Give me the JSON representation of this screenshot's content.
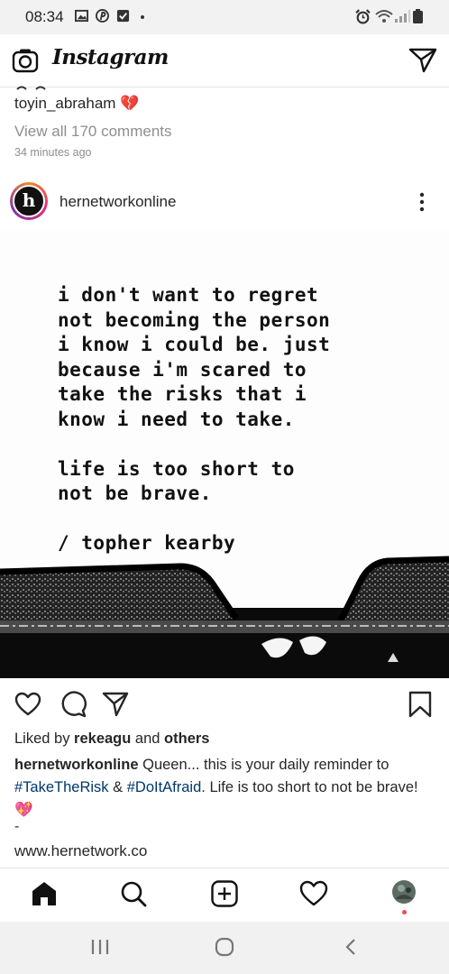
{
  "status_bar": {
    "time": "08:34"
  },
  "header": {
    "app_title": "Instagram"
  },
  "previous_post": {
    "username": "toyin_abraham",
    "username_emoji": "💔",
    "view_comments": "View all 170 comments",
    "time_ago": "34 minutes ago"
  },
  "post": {
    "avatar_letter": "h",
    "username": "hernetworkonline",
    "image_text": "i don't want to regret\nnot becoming the person\ni know i could be. just\nbecause i'm scared to\ntake the risks that i\nknow i need to take.\n\nlife is too short to\nnot be brave.\n\n/ topher kearby",
    "likes_prefix": "Liked by ",
    "likes_user": "rekeagu",
    "likes_and": " and ",
    "likes_others": "others",
    "caption_user": "hernetworkonline",
    "caption_text1": " Queen... this is your daily reminder to ",
    "caption_tag1": "#TakeTheRisk",
    "caption_amp": " & ",
    "caption_tag2": "#DoItAfraid",
    "caption_text2": ". Life is too short to not be brave!",
    "caption_emoji": "💖",
    "dash": "-",
    "website": "www.hernetwork.co"
  },
  "icons": {
    "camera": "camera-icon",
    "direct": "direct-message-icon",
    "more": "more-options-icon",
    "like": "heart-icon",
    "comment": "comment-icon",
    "share": "share-icon",
    "save": "bookmark-icon",
    "home": "home-icon",
    "search": "search-icon",
    "add": "add-post-icon",
    "activity": "activity-heart-icon",
    "profile": "profile-avatar"
  },
  "colors": {
    "link": "#00376b",
    "text": "#262626",
    "muted": "#8e8e8e",
    "notification_dot": "#ed4956"
  }
}
